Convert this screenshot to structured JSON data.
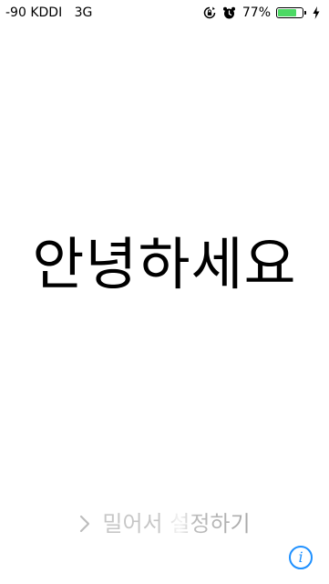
{
  "status_bar": {
    "signal": "-90",
    "carrier": "KDDI",
    "network": "3G",
    "rotation_lock_icon": "rotation-lock-icon",
    "alarm_icon": "alarm-clock-icon",
    "battery_percent_text": "77%",
    "battery_level": 0.77,
    "battery_color": "#4cd964",
    "charging_icon": "lightning-bolt-icon"
  },
  "lock_screen": {
    "greeting": "안녕하세요",
    "slide_label": "밀어서 설정하기",
    "info_glyph": "i",
    "info_color": "#1e90ff"
  }
}
